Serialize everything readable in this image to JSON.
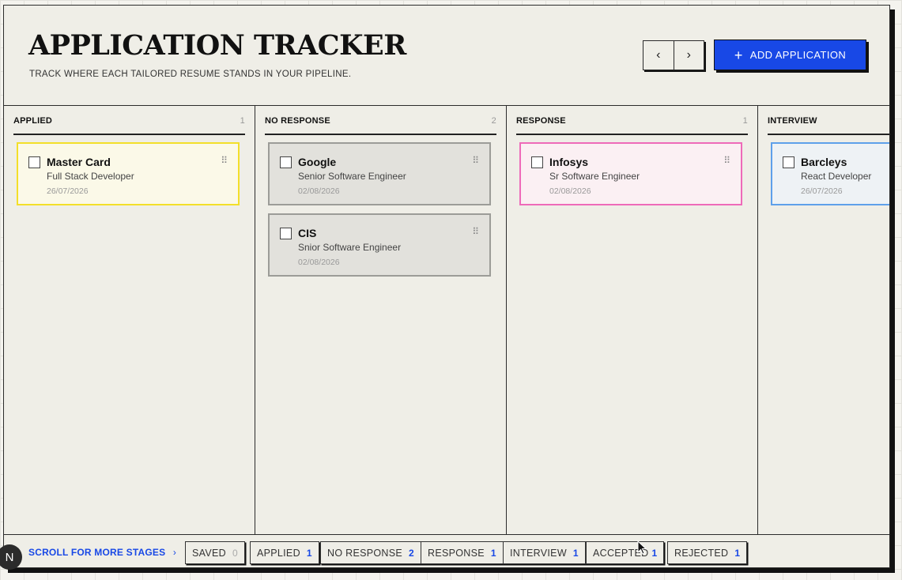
{
  "header": {
    "title": "APPLICATION TRACKER",
    "subtitle": "TRACK WHERE EACH TAILORED RESUME STANDS IN YOUR PIPELINE.",
    "prev_icon": "chevron-left",
    "next_icon": "chevron-right",
    "prev_glyph": "‹",
    "next_glyph": "›",
    "add_plus": "+",
    "add_label": "ADD APPLICATION"
  },
  "columns": [
    {
      "title": "APPLIED",
      "count": "1",
      "cards": [
        {
          "company": "Master Card",
          "role": "Full Stack Developer",
          "date": "26/07/2026",
          "border": "#f3df2a",
          "bg": "#fbf9e8"
        }
      ]
    },
    {
      "title": "NO RESPONSE",
      "count": "2",
      "cards": [
        {
          "company": "Google",
          "role": "Senior Software Engineer",
          "date": "02/08/2026",
          "border": "#9c9c98",
          "bg": "#e2e1dc"
        },
        {
          "company": "CIS",
          "role": "Snior Software Engineer",
          "date": "02/08/2026",
          "border": "#9c9c98",
          "bg": "#e2e1dc"
        }
      ]
    },
    {
      "title": "RESPONSE",
      "count": "1",
      "cards": [
        {
          "company": "Infosys",
          "role": "Sr Software Engineer",
          "date": "02/08/2026",
          "border": "#ee6ab9",
          "bg": "#fbf0f3"
        }
      ]
    },
    {
      "title": "INTERVIEW",
      "count": "",
      "cards": [
        {
          "company": "Barcleys",
          "role": "React Developer",
          "date": "26/07/2026",
          "border": "#5ea0ea",
          "bg": "#eef2f5"
        }
      ]
    }
  ],
  "footer": {
    "scroll_label": "SCROLL FOR MORE STAGES",
    "scroll_glyph": "›",
    "chips": [
      {
        "label": "SAVED",
        "count": "0"
      },
      {
        "label": "APPLIED",
        "count": "1"
      },
      {
        "label": "NO RESPONSE",
        "count": "2"
      },
      {
        "label": "RESPONSE",
        "count": "1"
      },
      {
        "label": "INTERVIEW",
        "count": "1"
      },
      {
        "label": "ACCEPTED",
        "count": "1"
      },
      {
        "label": "REJECTED",
        "count": "1"
      }
    ]
  },
  "avatar": {
    "initial": "N"
  },
  "grip_glyph": "⠿",
  "colors": {
    "accent": "#1848e6"
  }
}
